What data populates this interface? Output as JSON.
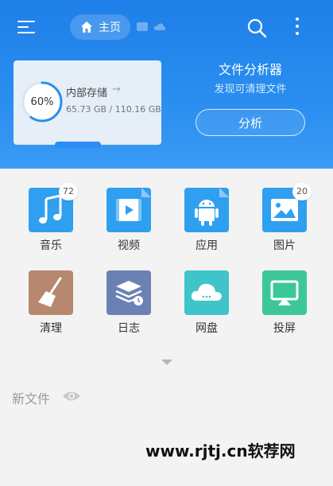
{
  "header": {
    "home_label": "主页",
    "icons": [
      "menu-icon",
      "home-icon",
      "message-icon",
      "cloud-icon",
      "search-icon",
      "more-vertical-icon"
    ]
  },
  "storage": {
    "percent_label": "60%",
    "used_fraction": 0.6,
    "title": "内部存储",
    "arrow": "→",
    "size_text": "65.73 GB / 110.16 GB"
  },
  "analyzer": {
    "title": "文件分析器",
    "subtitle": "发现可清理文件",
    "button_label": "分析"
  },
  "categories": [
    {
      "label": "音乐",
      "badge": "72",
      "icon": "music-icon",
      "color": "#2f9ff0"
    },
    {
      "label": "视频",
      "badge": "",
      "icon": "video-icon",
      "color": "#2f9ff0"
    },
    {
      "label": "应用",
      "badge": "",
      "icon": "android-icon",
      "color": "#2f9ff0"
    },
    {
      "label": "图片",
      "badge": "20",
      "icon": "image-icon",
      "color": "#2f9ff0"
    },
    {
      "label": "清理",
      "badge": "",
      "icon": "broom-icon",
      "color": "#b78770"
    },
    {
      "label": "日志",
      "badge": "",
      "icon": "log-icon",
      "color": "#6a82b3"
    },
    {
      "label": "网盘",
      "badge": "",
      "icon": "cloud-drive-icon",
      "color": "#3fc5c9"
    },
    {
      "label": "投屏",
      "badge": "",
      "icon": "cast-icon",
      "color": "#3cc79a"
    }
  ],
  "new_files": {
    "label": "新文件"
  },
  "watermark": "www.rjtj.cn软荐网",
  "colors": {
    "header_blue": "#2a8ef0",
    "ring_blue": "#2a8ef0"
  }
}
